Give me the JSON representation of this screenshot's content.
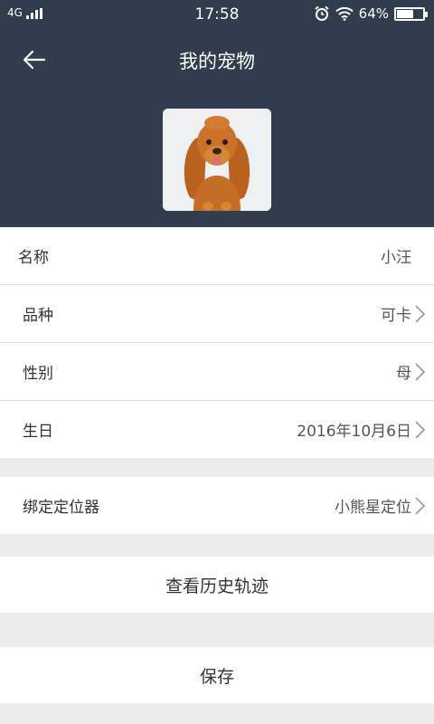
{
  "status_bar": {
    "network": "4G",
    "time": "17:58",
    "battery": "64%",
    "battery_level": 0.64,
    "alarm_icon": "alarm-clock-icon",
    "wifi_icon": "wifi-icon"
  },
  "header": {
    "title": "我的宠物",
    "back_icon": "arrow-left-icon",
    "background_color": "#313d4f"
  },
  "pet": {
    "avatar": "dog-photo"
  },
  "fields": [
    {
      "label": "名称",
      "value": "小汪"
    },
    {
      "label": "品种",
      "value": "可卡"
    },
    {
      "label": "性别",
      "value": "母"
    },
    {
      "label": "生日",
      "value": "2016年10月6日"
    }
  ],
  "device": {
    "label": "绑定定位器",
    "value": "小熊星定位"
  },
  "actions": {
    "history": "查看历史轨迹",
    "save": "保存"
  }
}
